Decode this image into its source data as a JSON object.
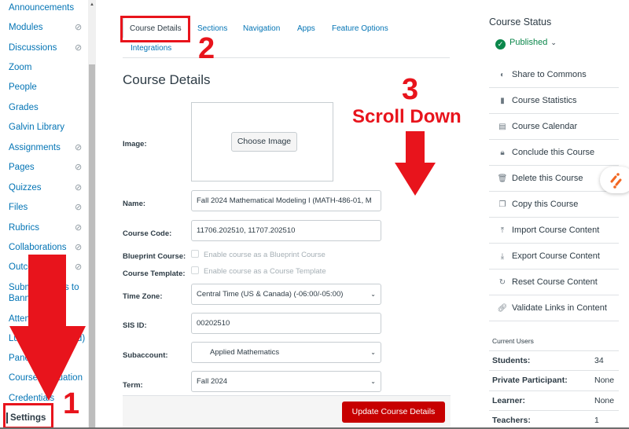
{
  "sidebar": {
    "items": [
      {
        "label": "Announcements",
        "hidden": false
      },
      {
        "label": "Modules",
        "hidden": true
      },
      {
        "label": "Discussions",
        "hidden": true
      },
      {
        "label": "Zoom",
        "hidden": false
      },
      {
        "label": "People",
        "hidden": false
      },
      {
        "label": "Grades",
        "hidden": false
      },
      {
        "label": "Galvin Library",
        "hidden": false
      },
      {
        "label": "Assignments",
        "hidden": true
      },
      {
        "label": "Pages",
        "hidden": true
      },
      {
        "label": "Quizzes",
        "hidden": true
      },
      {
        "label": "Files",
        "hidden": true
      },
      {
        "label": "Rubrics",
        "hidden": true
      },
      {
        "label": "Collaborations",
        "hidden": true
      },
      {
        "label": "Outcomes",
        "hidden": true
      },
      {
        "label": "Submit Grades to",
        "label2": "Banner",
        "hidden": false
      },
      {
        "label": "Attendance",
        "hidden": false
      },
      {
        "label": "Lucid (Whiteboard)",
        "hidden": false
      },
      {
        "label": "Panopto",
        "hidden": false
      },
      {
        "label": "Course Evaluation",
        "hidden": false
      },
      {
        "label": "Credentials",
        "hidden": false
      },
      {
        "label": "Settings",
        "hidden": false,
        "active": true
      }
    ],
    "hidden_icon": "eye-slash-icon"
  },
  "tabs": [
    {
      "label": "Course Details",
      "active": true
    },
    {
      "label": "Sections"
    },
    {
      "label": "Navigation"
    },
    {
      "label": "Apps"
    },
    {
      "label": "Feature Options"
    },
    {
      "label": "Integrations"
    }
  ],
  "page_title": "Course Details",
  "form": {
    "image_label": "Image:",
    "choose_image": "Choose Image",
    "name_label": "Name:",
    "name_value": "Fall 2024 Mathematical Modeling I (MATH-486-01, M",
    "course_code_label": "Course Code:",
    "course_code_value": "11706.202510, 11707.202510",
    "blueprint_label": "Blueprint Course:",
    "blueprint_text": "Enable course as a Blueprint Course",
    "template_label": "Course Template:",
    "template_text": "Enable course as a Course Template",
    "timezone_label": "Time Zone:",
    "timezone_value": "Central Time (US & Canada) (-06:00/-05:00)",
    "sis_label": "SIS ID:",
    "sis_value": "00202510",
    "subaccount_label": "Subaccount:",
    "subaccount_value": "Applied Mathematics",
    "term_label": "Term:",
    "term_value": "Fall 2024",
    "update_button": "Update Course Details"
  },
  "course_status": {
    "title": "Course Status",
    "status": "Published",
    "status_color": "#0b874b",
    "links": [
      {
        "icon": "share-commons-icon",
        "glyph": "◐",
        "label": "Share to Commons"
      },
      {
        "icon": "bar-chart-icon",
        "glyph": "▮",
        "label": "Course Statistics"
      },
      {
        "icon": "calendar-icon",
        "glyph": "▤",
        "label": "Course Calendar"
      },
      {
        "icon": "lock-icon",
        "glyph": "🔒︎",
        "label": "Conclude this Course"
      },
      {
        "icon": "trash-icon",
        "glyph": "🗑︎",
        "label": "Delete this Course"
      },
      {
        "icon": "copy-icon",
        "glyph": "❐",
        "label": "Copy this Course"
      },
      {
        "icon": "upload-icon",
        "glyph": "⤒",
        "label": "Import Course Content"
      },
      {
        "icon": "download-icon",
        "glyph": "⤓",
        "label": "Export Course Content"
      },
      {
        "icon": "reset-icon",
        "glyph": "↻",
        "label": "Reset Course Content"
      },
      {
        "icon": "link-icon",
        "glyph": "🔗︎",
        "label": "Validate Links in Content"
      }
    ]
  },
  "current_users": {
    "title": "Current Users",
    "rows": [
      {
        "label": "Students:",
        "value": "34"
      },
      {
        "label": "Private Participant:",
        "value": "None"
      },
      {
        "label": "Learner:",
        "value": "None"
      },
      {
        "label": "Teachers:",
        "value": "1"
      }
    ]
  },
  "annotations": {
    "step1": "1",
    "step2": "2",
    "step3": "3",
    "scroll_down": "Scroll Down",
    "color": "#e8141c"
  }
}
